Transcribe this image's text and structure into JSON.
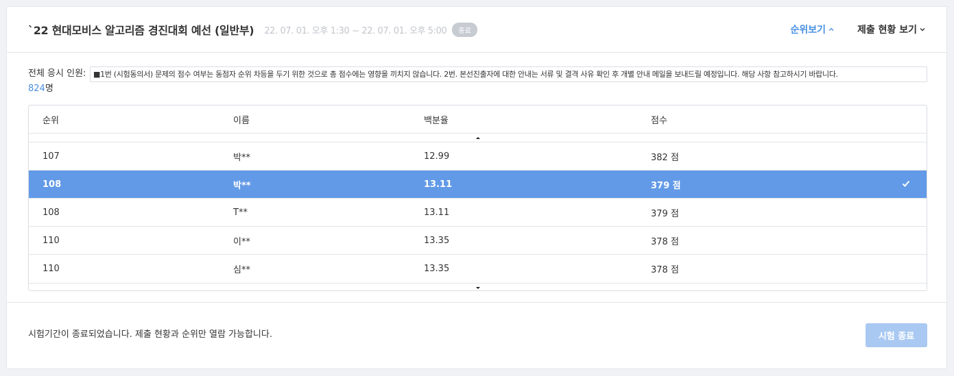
{
  "header": {
    "title": "`22 현대모비스 알고리즘 경진대회 예선 (일반부)",
    "period": "22. 07. 01. 오후 1:30 ~ 22. 07. 01. 오후 5:00",
    "status_badge": "종료",
    "ranking_label": "순위보기",
    "submission_status_label": "제출 현황 보기"
  },
  "info": {
    "total_label": "전체 응시 인원: ",
    "total_count": "824",
    "total_unit": "명",
    "notice": "■1번 (시험동의서) 문제의 점수 여부는 동점자 순위 차등을 두기 위한 것으로 총 점수에는 영향을 끼치지 않습니다. 2번. 본선진출자에 대한 안내는 서류 및 결격 사유 확인 후 개별 안내 메일을 보내드릴 예정입니다. 해당 사항 참고하시기 바랍니다."
  },
  "table": {
    "columns": [
      "순위",
      "이름",
      "백분율",
      "점수"
    ],
    "rows": [
      {
        "rank": "107",
        "name": "박**",
        "percent": "12.99",
        "score": "382 점",
        "selected": false
      },
      {
        "rank": "108",
        "name": "박**",
        "percent": "13.11",
        "score": "379 점",
        "selected": true
      },
      {
        "rank": "108",
        "name": "T**",
        "percent": "13.11",
        "score": "379 점",
        "selected": false
      },
      {
        "rank": "110",
        "name": "이**",
        "percent": "13.35",
        "score": "378 점",
        "selected": false
      },
      {
        "rank": "110",
        "name": "심**",
        "percent": "13.35",
        "score": "378 점",
        "selected": false
      }
    ]
  },
  "footer": {
    "message": "시험기간이 종료되었습니다. 제출 현황과 순위만 열람 가능합니다.",
    "end_button": "시험 종료"
  },
  "colors": {
    "accent": "#4a90e2",
    "selected_row": "#629ae7",
    "disabled_button": "#a9c9f2"
  },
  "icons": {
    "ranking_chevron": "chevron-up-icon",
    "status_chevron": "chevron-down-icon",
    "selected_row": "check-icon",
    "scroll_up": "scroll-up-arrow-icon",
    "scroll_down": "scroll-down-arrow-icon"
  }
}
